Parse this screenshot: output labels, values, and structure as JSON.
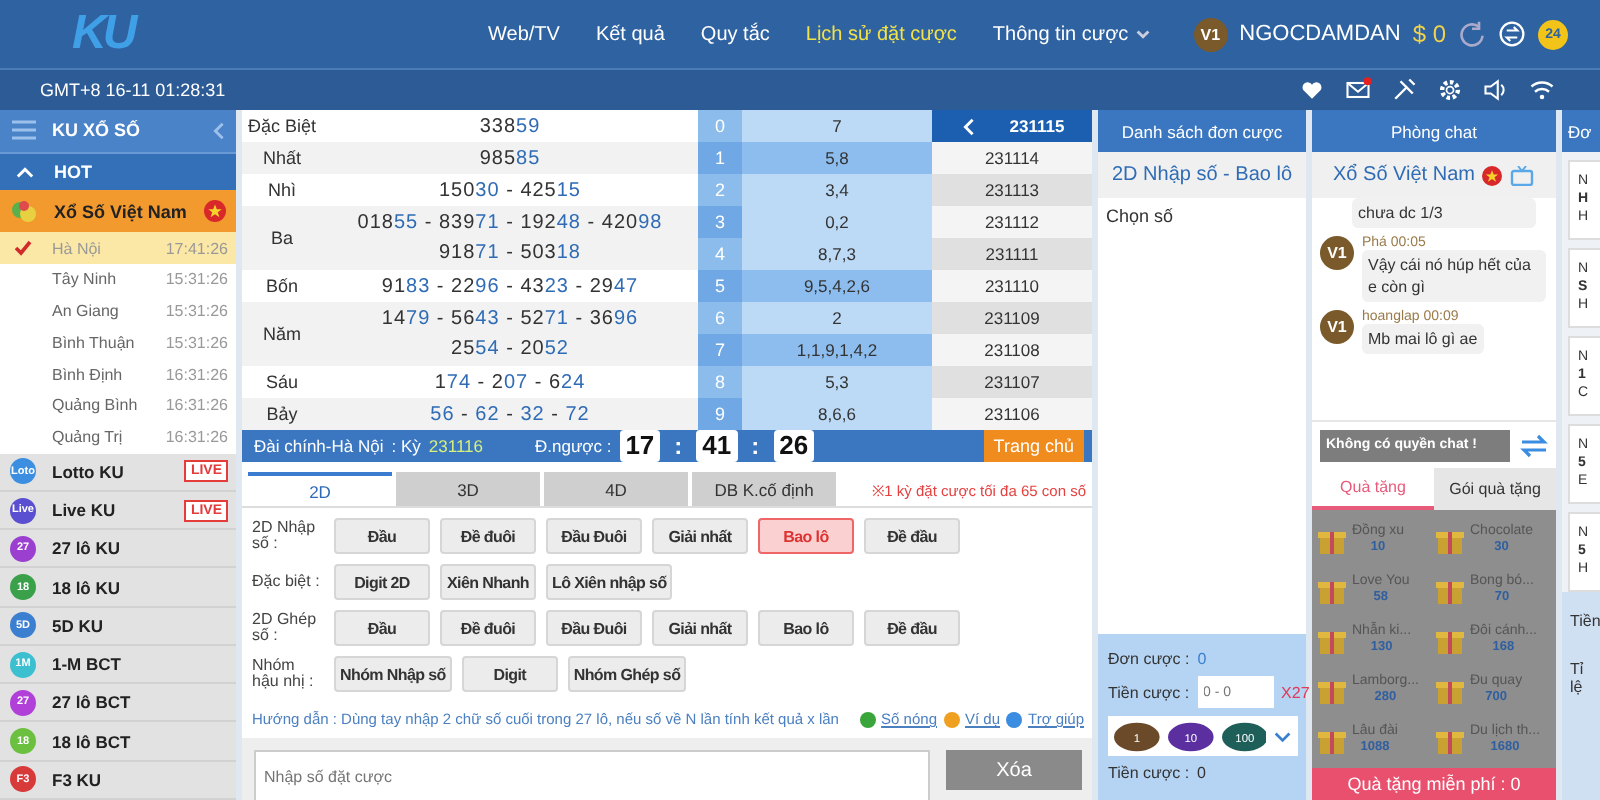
{
  "header": {
    "logo": "KU",
    "nav": [
      {
        "label": "Web/TV",
        "selected": false,
        "dropdown": false
      },
      {
        "label": "Kết quả",
        "selected": false,
        "dropdown": false
      },
      {
        "label": "Quy tắc",
        "selected": false,
        "dropdown": false
      },
      {
        "label": "Lịch sử đặt cược",
        "selected": true,
        "dropdown": false
      },
      {
        "label": "Thông tin cược",
        "selected": false,
        "dropdown": true
      }
    ],
    "level_badge": "V1",
    "username": "NGOCDAMDAN",
    "balance": "$ 0",
    "support_badge": "24"
  },
  "status_bar": {
    "clock": "GMT+8 16-11 01:28:31",
    "mail_unread": true
  },
  "sidebar": {
    "title": "KU XỔ SỐ",
    "section": {
      "label": "HOT",
      "expanded": true
    },
    "featured": "Xổ Số Việt Nam",
    "regions": [
      {
        "name": "Hà Nội",
        "time": "17:41:26",
        "selected": true
      },
      {
        "name": "Tây Ninh",
        "time": "15:31:26",
        "selected": false
      },
      {
        "name": "An Giang",
        "time": "15:31:26",
        "selected": false
      },
      {
        "name": "Bình Thuận",
        "time": "15:31:26",
        "selected": false
      },
      {
        "name": "Bình Định",
        "time": "16:31:26",
        "selected": false
      },
      {
        "name": "Quảng Bình",
        "time": "16:31:26",
        "selected": false
      },
      {
        "name": "Quảng Trị",
        "time": "16:31:26",
        "selected": false
      }
    ],
    "games": [
      {
        "badge": "Loto",
        "name": "Lotto KU",
        "color": "#3b8ee0",
        "live_badge": "LIVE"
      },
      {
        "badge": "Live",
        "name": "Live KU",
        "color": "#5a4fd0",
        "live_badge": "LIVE"
      },
      {
        "badge": "27",
        "name": "27 lô KU",
        "color": "#9a3fd0"
      },
      {
        "badge": "18",
        "name": "18 lô KU",
        "color": "#3aa04a"
      },
      {
        "badge": "5D",
        "name": "5D KU",
        "color": "#3a7fd0"
      },
      {
        "badge": "1M",
        "name": "1-M BCT",
        "color": "#3cc0d0"
      },
      {
        "badge": "27",
        "name": "27 lô BCT",
        "color": "#b040d8"
      },
      {
        "badge": "18",
        "name": "18 lô BCT",
        "color": "#6cc040"
      },
      {
        "badge": "F3",
        "name": "F3 KU",
        "color": "#d83a3a"
      }
    ]
  },
  "results": {
    "rows": [
      {
        "prize": "Đặc Biệt",
        "lines": [
          "33859"
        ]
      },
      {
        "prize": "Nhất",
        "lines": [
          "98585"
        ]
      },
      {
        "prize": "Nhì",
        "lines": [
          "15030 - 42515"
        ]
      },
      {
        "prize": "Ba",
        "lines": [
          "01855 - 83971 - 19248 - 42098",
          "91871 - 50318"
        ]
      },
      {
        "prize": "Bốn",
        "lines": [
          "9183 - 2296 - 4323 - 2947"
        ]
      },
      {
        "prize": "Năm",
        "lines": [
          "1479 - 5643 - 5271 - 3696",
          "2554 - 2052"
        ]
      },
      {
        "prize": "Sáu",
        "lines": [
          "174 - 207 - 624"
        ]
      },
      {
        "prize": "Bảy",
        "lines": [
          "56 - 62 - 32 - 72"
        ]
      }
    ],
    "digits": [
      {
        "digit": "0",
        "values": "7",
        "highlighted": false
      },
      {
        "digit": "1",
        "values": "5,8",
        "highlighted": true
      },
      {
        "digit": "2",
        "values": "3,4",
        "highlighted": false
      },
      {
        "digit": "3",
        "values": "0,2",
        "highlighted": false
      },
      {
        "digit": "4",
        "values": "8,7,3",
        "highlighted": false
      },
      {
        "digit": "5",
        "values": "9,5,4,2,6",
        "highlighted": true
      },
      {
        "digit": "6",
        "values": "2",
        "highlighted": false
      },
      {
        "digit": "7",
        "values": "1,1,9,1,4,2",
        "highlighted": true
      },
      {
        "digit": "8",
        "values": "5,3",
        "highlighted": false
      },
      {
        "digit": "9",
        "values": "8,6,6",
        "highlighted": false
      }
    ],
    "periods": [
      {
        "label": "231115",
        "selected": true
      },
      {
        "label": "231114",
        "selected": false
      },
      {
        "label": "231113",
        "selected": false
      },
      {
        "label": "231112",
        "selected": false
      },
      {
        "label": "231111",
        "selected": false
      },
      {
        "label": "231110",
        "selected": false
      },
      {
        "label": "231109",
        "selected": false
      },
      {
        "label": "231108",
        "selected": false
      },
      {
        "label": "231107",
        "selected": false
      },
      {
        "label": "231106",
        "selected": false
      }
    ]
  },
  "draw_bar": {
    "station": "Đài chính-Hà Nội",
    "period_label": ":  Kỳ",
    "period": "231116",
    "countdown_label": "Đ.ngược :",
    "countdown": [
      {
        "kind": "digits",
        "text": "17"
      },
      {
        "kind": "sep",
        "text": ":"
      },
      {
        "kind": "digits",
        "text": "41"
      },
      {
        "kind": "sep",
        "text": ":"
      },
      {
        "kind": "digits",
        "text": "26"
      }
    ],
    "home_button": "Trang chủ"
  },
  "bet": {
    "tabs": [
      {
        "label": "2D",
        "selected": true
      },
      {
        "label": "3D",
        "selected": false
      },
      {
        "label": "4D",
        "selected": false
      },
      {
        "label": "DB K.cố định",
        "selected": false
      }
    ],
    "limit_note": "※1 kỳ đặt cược tối đa 65 con số",
    "groups": [
      {
        "label": "2D Nhập số :",
        "options": [
          {
            "label": "Đầu",
            "selected": false
          },
          {
            "label": "Đề đuôi",
            "selected": false
          },
          {
            "label": "Đầu Đuôi",
            "selected": false
          },
          {
            "label": "Giải nhất",
            "selected": false
          },
          {
            "label": "Bao lô",
            "selected": true
          },
          {
            "label": "Đề đầu",
            "selected": false
          }
        ]
      },
      {
        "label": "Đặc biệt :",
        "options": [
          {
            "label": "Digit 2D",
            "selected": false
          },
          {
            "label": "Xiên Nhanh",
            "selected": false
          },
          {
            "label": "Lô Xiên nhập số",
            "selected": false
          }
        ]
      },
      {
        "label": "2D Ghép số :",
        "options": [
          {
            "label": "Đầu",
            "selected": false
          },
          {
            "label": "Đề đuôi",
            "selected": false
          },
          {
            "label": "Đầu Đuôi",
            "selected": false
          },
          {
            "label": "Giải nhất",
            "selected": false
          },
          {
            "label": "Bao lô",
            "selected": false
          },
          {
            "label": "Đề đầu",
            "selected": false
          }
        ]
      },
      {
        "label": "Nhóm hậu nhị :",
        "options": [
          {
            "label": "Nhóm Nhập số",
            "selected": false
          },
          {
            "label": "Digit",
            "selected": false
          },
          {
            "label": "Nhóm Ghép số",
            "selected": false
          }
        ]
      }
    ],
    "guide": "Hướng dẫn : Dùng tay nhập 2 chữ số cuối trong 27 lô, nếu số về N lần tính kết quả x lần",
    "links": [
      {
        "label": "Số nóng",
        "color": "#3aa53a"
      },
      {
        "label": "Ví dụ",
        "color": "#f0a020"
      },
      {
        "label": "Trợ giúp",
        "color": "#3a8de0"
      }
    ],
    "input_placeholder": "Nhập số đặt cược",
    "clear_button": "Xóa"
  },
  "order_list": {
    "title": "Danh sách đơn cược",
    "selection": "2D Nhập số - Bao lô",
    "hint": "Chọn số",
    "order_count_label": "Đơn cược :",
    "order_count": "0",
    "stake_label": "Tiền cược :",
    "stake_placeholder": "0 - 0",
    "multiplier": "X27",
    "chips": [
      {
        "value": "1",
        "color": "#6b4a2a"
      },
      {
        "value": "10",
        "color": "#5b2fa0"
      },
      {
        "value": "100",
        "color": "#1f5f5a"
      }
    ],
    "total_label": "Tiền cược :",
    "total": "0"
  },
  "chat": {
    "title": "Phòng chat",
    "room": "Xổ Số Việt Nam",
    "messages": [
      {
        "text": "chưa dc 1/3"
      },
      {
        "avatar": "V1",
        "meta": "Phá 00:05",
        "text": "Vậy cái nó húp hết của e còn gì"
      },
      {
        "avatar": "V1",
        "meta": "hoanglap 00:09",
        "text": "Mb mai lô gì ae"
      }
    ],
    "input": "Không có quyền chat !",
    "gift_tabs": [
      {
        "label": "Quà tặng",
        "selected": true
      },
      {
        "label": "Gói quà tặng",
        "selected": false
      }
    ],
    "gifts": [
      {
        "name": "Đồng xu",
        "price": "10"
      },
      {
        "name": "Chocolate",
        "price": "30"
      },
      {
        "name": "Love You",
        "price": "58"
      },
      {
        "name": "Bong bó...",
        "price": "70"
      },
      {
        "name": "Nhẫn ki...",
        "price": "130"
      },
      {
        "name": "Đôi cánh...",
        "price": "168"
      },
      {
        "name": "Lamborg...",
        "price": "280"
      },
      {
        "name": "Đu quay",
        "price": "700"
      },
      {
        "name": "Lâu đài",
        "price": "1088"
      },
      {
        "name": "Du lịch th...",
        "price": "1680"
      }
    ],
    "free_gifts": "Quà tặng miễn phí : 0"
  },
  "side_panel": {
    "header": "Đơ",
    "cards": [
      [
        "N",
        "H",
        "H"
      ],
      [
        "N",
        "S",
        "H"
      ],
      [
        "N",
        "1",
        "C"
      ],
      [
        "N",
        "5",
        "E"
      ],
      [
        "N",
        "5",
        "H"
      ]
    ],
    "footer": [
      "Tiền",
      "Tỉ lệ"
    ]
  }
}
